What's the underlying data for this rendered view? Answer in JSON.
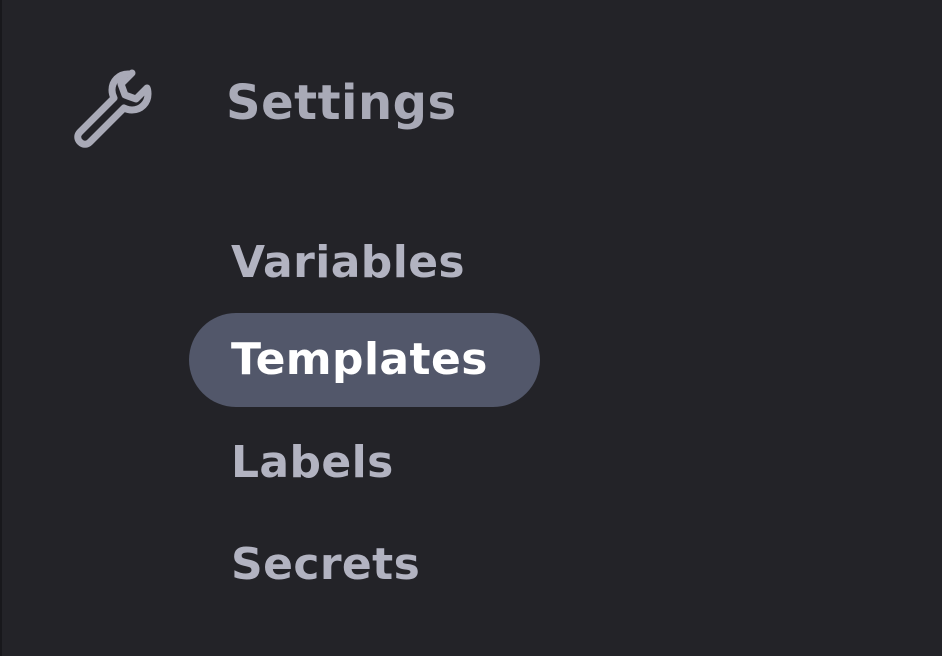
{
  "sidebar": {
    "header": {
      "icon": "wrench-icon",
      "title": "Settings"
    },
    "items": [
      {
        "label": "Variables",
        "active": false
      },
      {
        "label": "Templates",
        "active": true
      },
      {
        "label": "Labels",
        "active": false
      },
      {
        "label": "Secrets",
        "active": false
      }
    ]
  },
  "colors": {
    "background": "#232328",
    "active_pill": "#52576a",
    "text": "#b2b3c1",
    "active_text": "#ffffff"
  }
}
